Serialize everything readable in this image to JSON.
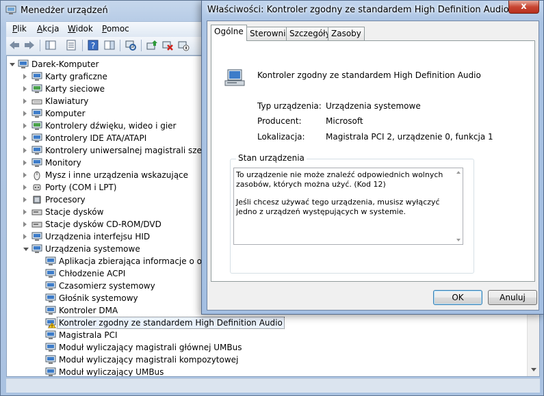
{
  "device_manager": {
    "title": "Menedżer urządzeń",
    "menu": [
      {
        "label": "Plik",
        "accel": "P",
        "rest": "lik"
      },
      {
        "label": "Akcja",
        "accel": "A",
        "rest": "kcja"
      },
      {
        "label": "Widok",
        "accel": "W",
        "rest": "idok"
      },
      {
        "label": "Pomoc",
        "accel": "P",
        "rest": "omoc"
      }
    ],
    "tree": {
      "root": "Darek-Komputer",
      "categories": [
        "Karty graficzne",
        "Karty sieciowe",
        "Klawiatury",
        "Komputer",
        "Kontrolery dźwięku, wideo i gier",
        "Kontrolery IDE ATA/ATAPI",
        "Kontrolery uniwersalnej magistrali szerego",
        "Monitory",
        "Mysz i inne urządzenia wskazujące",
        "Porty (COM i LPT)",
        "Procesory",
        "Stacje dysków",
        "Stacje dysków CD-ROM/DVD",
        "Urządzenia interfejsu HID",
        "Urządzenia systemowe"
      ],
      "system_devices": [
        "Aplikacja zbierająca informacje o oprog",
        "Chłodzenie ACPI",
        "Czasomierz systemowy",
        "Głośnik systemowy",
        "Kontroler DMA",
        "Kontroler zgodny ze standardem High Definition Audio",
        "Magistrala PCI",
        "Moduł wyliczający magistrali głównej UMBus",
        "Moduł wyliczający magistrali kompozytowej",
        "Moduł wyliczający UMBus"
      ],
      "selected": "Kontroler zgodny ze standardem High Definition Audio"
    }
  },
  "properties_dialog": {
    "title": "Właściwości: Kontroler zgodny ze standardem High Definition Audio",
    "close_label": "x",
    "tabs": [
      "Ogólne",
      "Sterownik",
      "Szczegóły",
      "Zasoby"
    ],
    "active_tab": "Ogólne",
    "device_name": "Kontroler zgodny ze standardem High Definition Audio",
    "properties": {
      "type_label": "Typ urządzenia:",
      "type_value": "Urządzenia systemowe",
      "manufacturer_label": "Producent:",
      "manufacturer_value": "Microsoft",
      "location_label": "Lokalizacja:",
      "location_value": "Magistrala PCI 2, urządzenie 0, funkcja 1"
    },
    "status": {
      "legend": "Stan urządzenia",
      "line1": "To urządzenie nie może znaleźć odpowiednich wolnych zasobów, których można użyć. (Kod 12)",
      "line2": "Jeśli chcesz używać tego urządzenia, musisz wyłączyć jedno z urządzeń występujących w systemie."
    },
    "buttons": {
      "ok": "OK",
      "cancel": "Anuluj"
    }
  },
  "colors": {
    "frame": "#aac2e1",
    "warning": "#f2c31a",
    "selection_bg": "#eaf2fc"
  }
}
